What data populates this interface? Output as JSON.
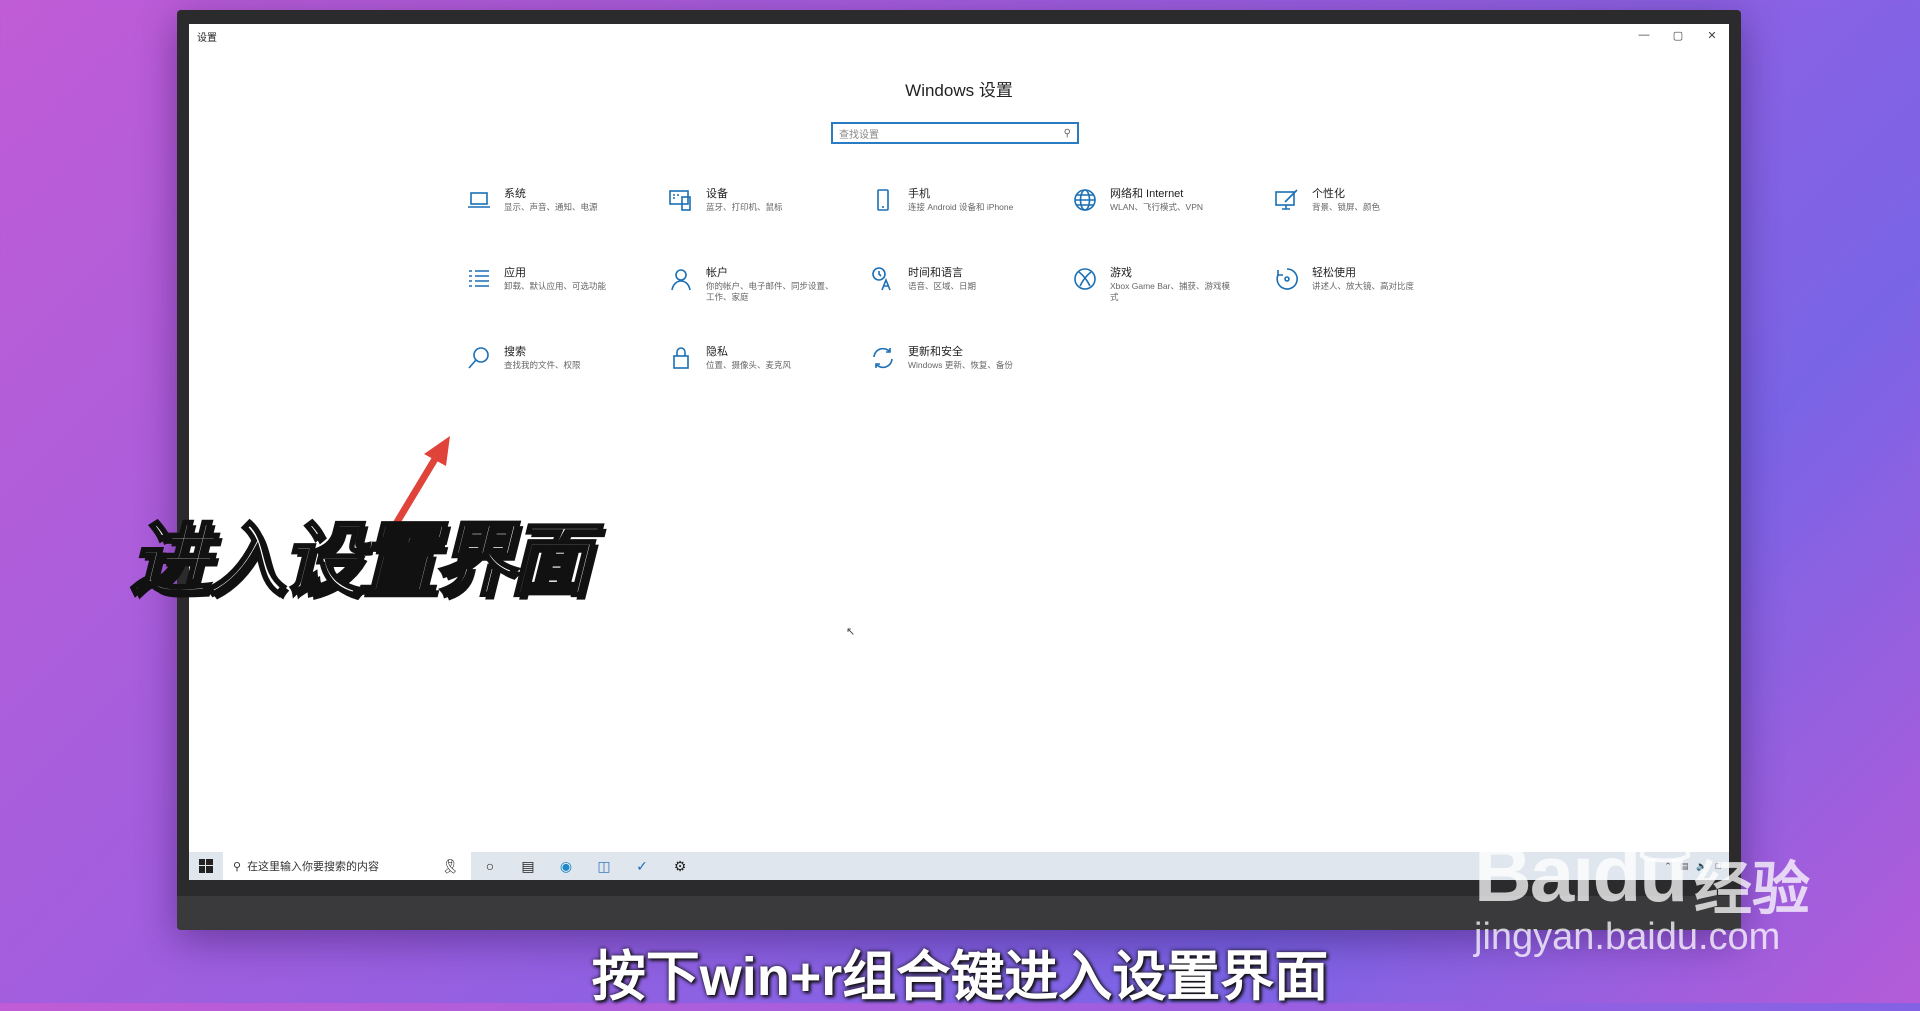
{
  "window": {
    "title": "设置",
    "minimize_glyph": "—",
    "maximize_glyph": "▢",
    "close_glyph": "✕"
  },
  "settings": {
    "heading": "Windows 设置",
    "search_placeholder": "查找设置",
    "items": [
      {
        "name": "系统",
        "desc": "显示、声音、通知、电源",
        "icon": "laptop-icon"
      },
      {
        "name": "设备",
        "desc": "蓝牙、打印机、鼠标",
        "icon": "devices-icon"
      },
      {
        "name": "手机",
        "desc": "连接 Android 设备和 iPhone",
        "icon": "phone-icon"
      },
      {
        "name": "网络和 Internet",
        "desc": "WLAN、飞行模式、VPN",
        "icon": "globe-icon"
      },
      {
        "name": "个性化",
        "desc": "背景、锁屏、颜色",
        "icon": "paint-icon"
      },
      {
        "name": "应用",
        "desc": "卸载、默认应用、可选功能",
        "icon": "apps-list-icon"
      },
      {
        "name": "帐户",
        "desc": "你的帐户、电子邮件、同步设置、工作、家庭",
        "icon": "person-icon"
      },
      {
        "name": "时间和语言",
        "desc": "语音、区域、日期",
        "icon": "time-language-icon"
      },
      {
        "name": "游戏",
        "desc": "Xbox Game Bar、捕获、游戏模式",
        "icon": "xbox-icon"
      },
      {
        "name": "轻松使用",
        "desc": "讲述人、放大镜、高对比度",
        "icon": "ease-of-access-icon"
      },
      {
        "name": "搜索",
        "desc": "查找我的文件、权限",
        "icon": "search-icon"
      },
      {
        "name": "隐私",
        "desc": "位置、摄像头、麦克风",
        "icon": "lock-icon"
      },
      {
        "name": "更新和安全",
        "desc": "Windows 更新、恢复、备份",
        "icon": "sync-icon"
      }
    ]
  },
  "taskbar": {
    "search_placeholder": "在这里输入你要搜索的内容",
    "icons": [
      "cortana-circle-icon",
      "task-view-icon",
      "edge-icon",
      "files-icon",
      "mail-icon",
      "gear-icon"
    ]
  },
  "overlay": {
    "title": "进入设置界面",
    "caption": "按下win+r组合键进入设置界面"
  },
  "watermark": {
    "logo": "Baidu",
    "cn": "经验",
    "url": "jingyan.baidu.com"
  },
  "colors": {
    "accent": "#1a6fb5",
    "arrow": "#e0433a"
  }
}
